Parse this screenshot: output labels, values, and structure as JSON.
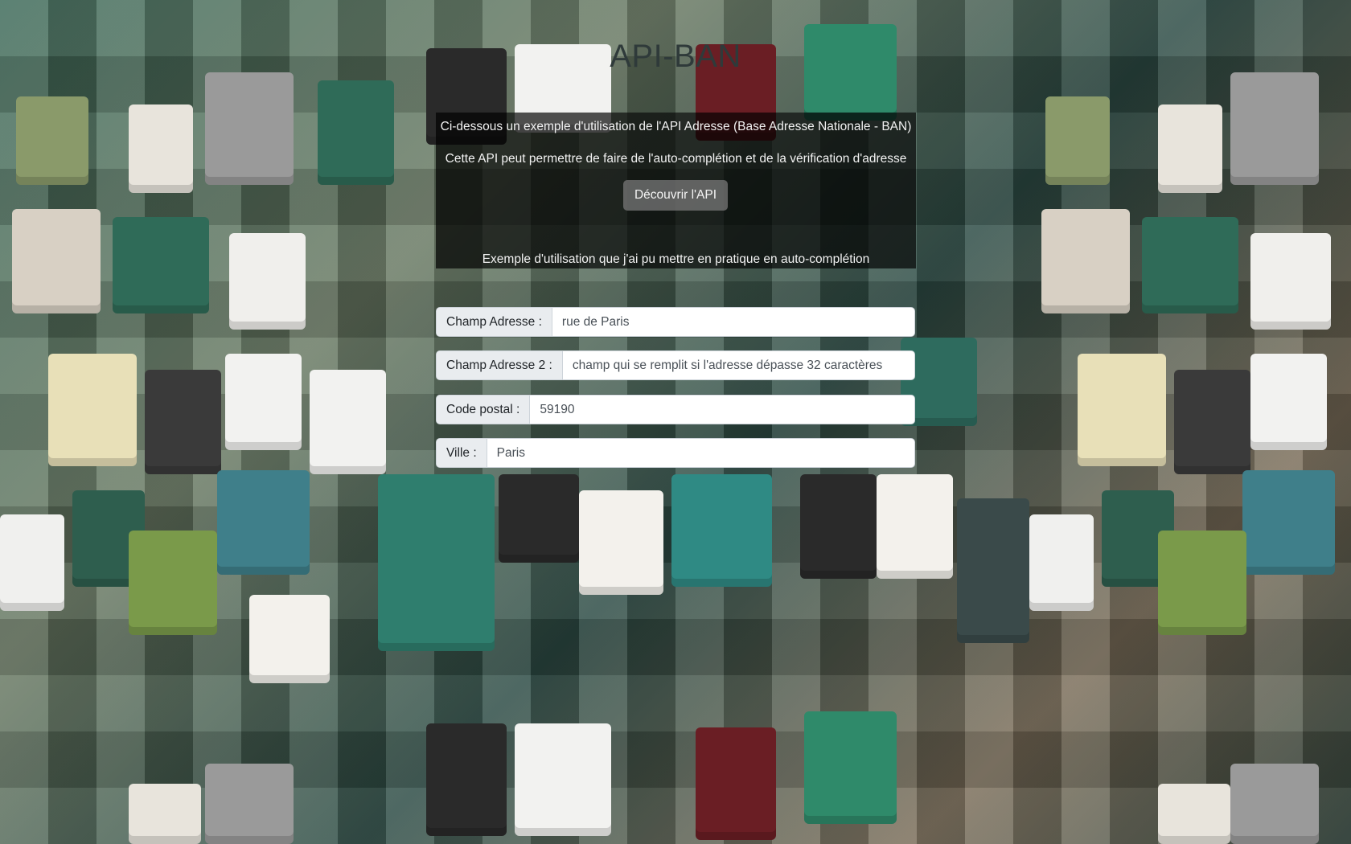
{
  "header": {
    "title": "API-BAN"
  },
  "intro": {
    "line1": "Ci-dessous un exemple d'utilisation de l'API Adresse (Base Adresse Nationale - BAN)",
    "line2": "Cette API peut permettre de faire de l'auto-complétion et de la vérification d'adresse",
    "discover_button": "Découvrir l'API",
    "line3": "Exemple d'utilisation que j'ai pu mettre en pratique en auto-complétion"
  },
  "form": {
    "adresse": {
      "label": "Champ Adresse :",
      "placeholder": "rue de Paris"
    },
    "adresse2": {
      "label": "Champ Adresse 2 :",
      "placeholder": "champ qui se remplit si l'adresse dépasse 32 caractères"
    },
    "code_postal": {
      "label": "Code postal :",
      "placeholder": "59190"
    },
    "ville": {
      "label": "Ville :",
      "placeholder": "Paris"
    }
  },
  "theme": {
    "panel_overlay": "#000000",
    "button_bg": "#787878",
    "addon_bg": "#e9ecef",
    "title_color": "#2f3a3a"
  }
}
